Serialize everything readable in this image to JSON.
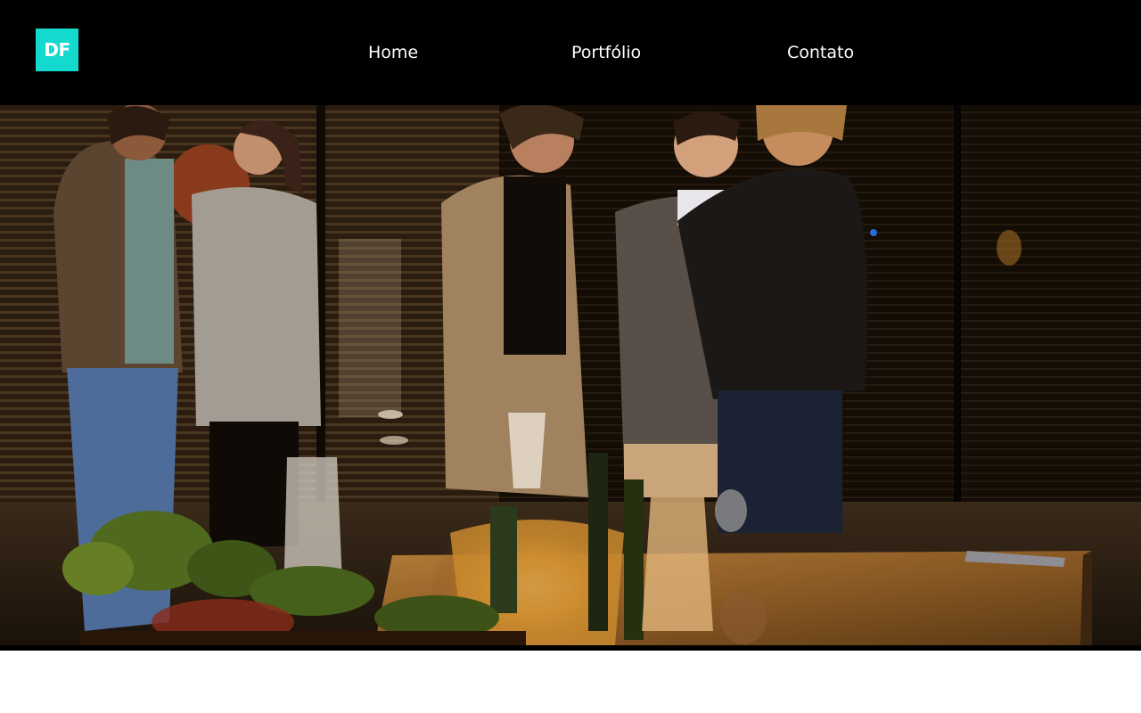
{
  "header": {
    "logo_text": "DF",
    "logo_color": "#14d9cf",
    "background": "#000000"
  },
  "nav": {
    "items": [
      {
        "label": "Home"
      },
      {
        "label": "Portfólio"
      },
      {
        "label": "Contato"
      }
    ]
  },
  "hero": {
    "image_icon": "hero-photo-icon",
    "palette": {
      "shadow": "#0d0803",
      "amber": "#c9852a",
      "warm_light": "#f3c98a",
      "table": "#8a5a25"
    }
  }
}
